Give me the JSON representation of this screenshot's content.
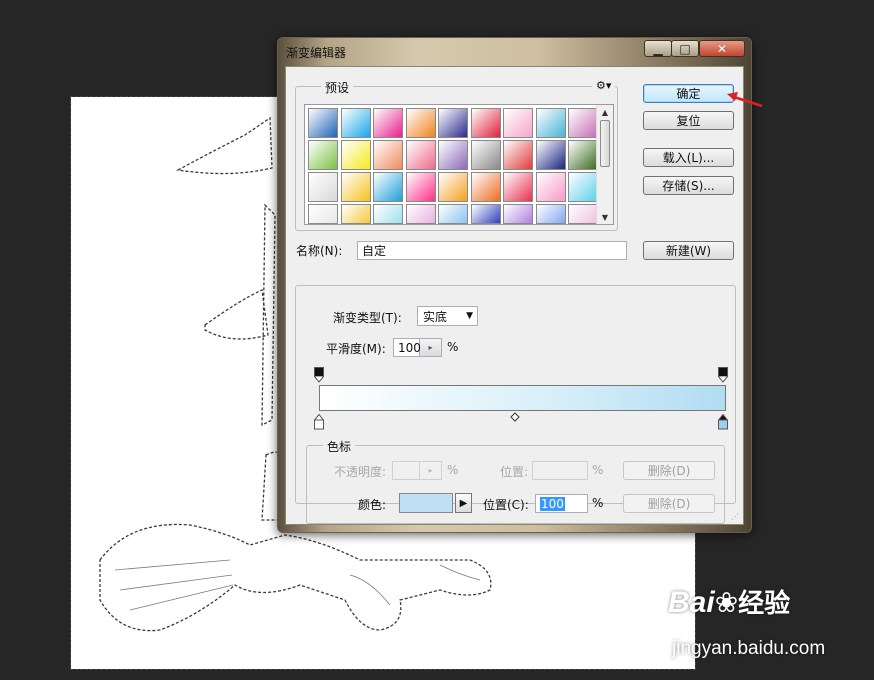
{
  "dialog": {
    "title": "渐变编辑器",
    "presets_legend": "预设",
    "buttons": {
      "ok": "确定",
      "reset": "复位",
      "load": "载入(L)...",
      "save": "存储(S)...",
      "new": "新建(W)"
    },
    "name_label": "名称(N):",
    "name_value": "自定",
    "gradient_type_label": "渐变类型(T):",
    "gradient_type_value": "实底",
    "smoothness_label": "平滑度(M):",
    "smoothness_value": "100",
    "percent": "%",
    "stops_legend": "色标",
    "opacity_label": "不透明度:",
    "opacity_position_label": "位置:",
    "delete_label": "删除(D)",
    "color_label": "颜色:",
    "color_position_label": "位置(C):",
    "color_position_value": "100",
    "selected_color": "#bfe0f4"
  },
  "preset_colors": [
    [
      "#1e63b5",
      "#19a6e6",
      "#e91e8c",
      "#f0831e",
      "#2a2a8c",
      "#e0203a",
      "#f5a6c8",
      "#46b3d6",
      "#c46fb4"
    ],
    [
      "#7dc142",
      "#f4ea1c",
      "#f08a5d",
      "#f06a8a",
      "#8a6ab8",
      "#888888",
      "#e03a3a",
      "#1a237e",
      "#3d6b1f"
    ],
    [
      "#d8d8d8",
      "#f4c21c",
      "#1ea0d8",
      "#ff2e88",
      "#f4a020",
      "#f06a20",
      "#e83050",
      "#f59ac8",
      "#5ad0e8"
    ],
    [
      "#e8e8e8",
      "#f6ca3c",
      "#9ee0f0",
      "#e8b0e0",
      "#8ac4f0",
      "#3040c0",
      "#b080e0",
      "#80a8f0",
      "#f0c0e0"
    ]
  ],
  "watermark": {
    "brand": "Bai",
    "brand2": "经验",
    "url": "jingyan.baidu.com"
  }
}
